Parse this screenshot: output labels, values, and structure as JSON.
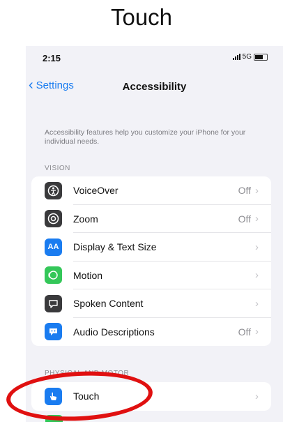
{
  "caption": "Touch",
  "status": {
    "time": "2:15",
    "network": "5G"
  },
  "nav": {
    "back_label": "Settings",
    "title": "Accessibility"
  },
  "description": "Accessibility features help you customize your iPhone for your individual needs.",
  "sections": {
    "vision": {
      "label": "VISION",
      "items": [
        {
          "label": "VoiceOver",
          "value": "Off",
          "icon": "voiceover-icon",
          "color": "#3a3a3c"
        },
        {
          "label": "Zoom",
          "value": "Off",
          "icon": "zoom-icon",
          "color": "#3a3a3c"
        },
        {
          "label": "Display & Text Size",
          "value": "",
          "icon": "text-size-icon",
          "color": "#1a7cf0"
        },
        {
          "label": "Motion",
          "value": "",
          "icon": "motion-icon",
          "color": "#34c759"
        },
        {
          "label": "Spoken Content",
          "value": "",
          "icon": "speech-bubble-icon",
          "color": "#3a3a3c"
        },
        {
          "label": "Audio Descriptions",
          "value": "Off",
          "icon": "audio-description-icon",
          "color": "#1a7cf0"
        }
      ]
    },
    "physical": {
      "label": "PHYSICAL AND MOTOR",
      "items": [
        {
          "label": "Touch",
          "value": "",
          "icon": "touch-hand-icon",
          "color": "#1a7cf0"
        }
      ]
    }
  },
  "colors": {
    "accent": "#1a7cf0",
    "highlight": "#e01010",
    "background": "#f2f2f7"
  }
}
